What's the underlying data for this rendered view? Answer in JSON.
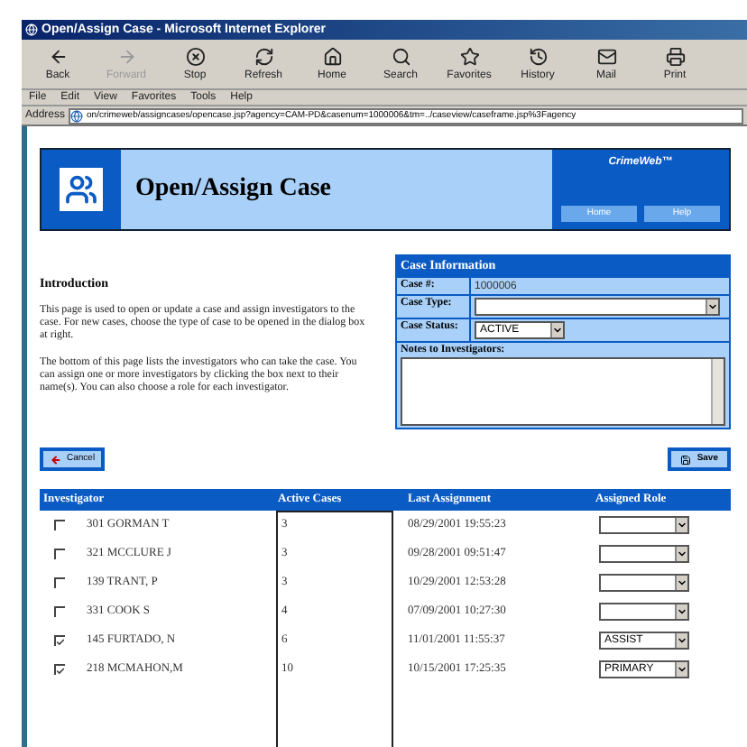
{
  "window": {
    "title": "Open/Assign Case - Microsoft Internet Explorer"
  },
  "toolbar": [
    {
      "label": "Back",
      "disabled": false
    },
    {
      "label": "Forward",
      "disabled": true
    },
    {
      "label": "Stop",
      "disabled": false
    },
    {
      "label": "Refresh",
      "disabled": false
    },
    {
      "label": "Home",
      "disabled": false
    },
    {
      "label": "Search",
      "disabled": false
    },
    {
      "label": "Favorites",
      "disabled": false
    },
    {
      "label": "History",
      "disabled": false
    },
    {
      "label": "Mail",
      "disabled": false
    },
    {
      "label": "Print",
      "disabled": false
    }
  ],
  "menu": [
    "File",
    "Edit",
    "View",
    "Favorites",
    "Tools",
    "Help"
  ],
  "address": {
    "label": "Address",
    "value": "on/crimeweb/assigncases/opencase.jsp?agency=CAM-PD&casenum=1000006&tm=../caseview/caseframe.jsp%3Fagency"
  },
  "banner": {
    "title": "Open/Assign Case",
    "brand": "CrimeWeb™",
    "buttons": [
      "Home",
      "Help"
    ]
  },
  "intro": {
    "heading": "Introduction",
    "paragraphs": [
      "This page is used to open or update a case and assign investigators to the case. For new cases, choose the type of case to be opened in the dialog box at right.",
      "The bottom of this page lists the investigators who can take the case. You can assign one or more investigators by clicking the box next to their name(s). You can also choose a role for each investigator."
    ]
  },
  "case_info": {
    "title": "Case Information",
    "fields": [
      {
        "label": "Case #:",
        "kind": "text",
        "value": "1000006"
      },
      {
        "label": "Case Type:",
        "kind": "select"
      },
      {
        "label": "Case Status:",
        "kind": "select",
        "value": "ACTIVE"
      }
    ],
    "notes_label": "Notes to Investigators:"
  },
  "actions": {
    "cancel": "Cancel",
    "save": "Save"
  },
  "table": {
    "columns": [
      "Investigator",
      "Active Cases",
      "Last Assignment",
      "Assigned Role"
    ],
    "rows": [
      {
        "checked": false,
        "name": "301 GORMAN T",
        "active_cases": "3",
        "last_assignment": "08/29/2001 19:55:23"
      },
      {
        "checked": false,
        "name": "321 MCCLURE J",
        "active_cases": "3",
        "last_assignment": "09/28/2001 09:51:47"
      },
      {
        "checked": false,
        "name": "139 TRANT, P",
        "active_cases": "3",
        "last_assignment": "10/29/2001 12:53:28"
      },
      {
        "checked": false,
        "name": "331 COOK S",
        "active_cases": "4",
        "last_assignment": "07/09/2001 10:27:30"
      },
      {
        "checked": true,
        "name": "145 FURTADO, N",
        "active_cases": "6",
        "last_assignment": "11/01/2001 11:55:37",
        "role": "ASSIST"
      },
      {
        "checked": true,
        "name": "218 MCMAHON,M",
        "active_cases": "10",
        "last_assignment": "10/15/2001 17:25:35",
        "role": "PRIMARY"
      }
    ]
  }
}
